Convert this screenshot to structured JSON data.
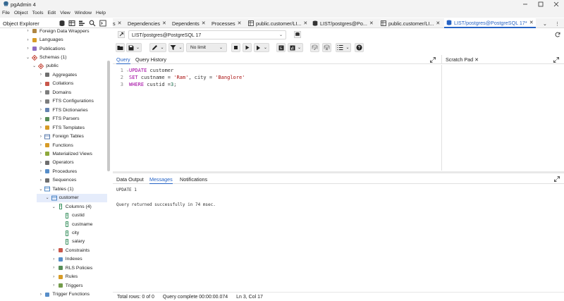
{
  "window": {
    "title": "pgAdmin 4",
    "controls": [
      "minimize",
      "maximize",
      "close"
    ]
  },
  "menu": [
    "File",
    "Object",
    "Tools",
    "Edit",
    "View",
    "Window",
    "Help"
  ],
  "object_explorer": {
    "title": "Object Explorer",
    "tree": [
      {
        "label": "Foreign Data Wrappers",
        "icon": "fdw-icon",
        "depth": 1,
        "state": "collapsed"
      },
      {
        "label": "Languages",
        "icon": "language-icon",
        "depth": 1,
        "state": "collapsed"
      },
      {
        "label": "Publications",
        "icon": "publication-icon",
        "depth": 1,
        "state": "collapsed"
      },
      {
        "label": "Schemas (1)",
        "icon": "schema-icon",
        "depth": 1,
        "state": "expanded"
      },
      {
        "label": "public",
        "icon": "public-schema-icon",
        "depth": 2,
        "state": "expanded"
      },
      {
        "label": "Aggregates",
        "icon": "aggregate-icon",
        "depth": 3,
        "state": "collapsed"
      },
      {
        "label": "Collations",
        "icon": "collation-icon",
        "depth": 3,
        "state": "collapsed"
      },
      {
        "label": "Domains",
        "icon": "domain-icon",
        "depth": 3,
        "state": "collapsed"
      },
      {
        "label": "FTS Configurations",
        "icon": "fts-config-icon",
        "depth": 3,
        "state": "collapsed"
      },
      {
        "label": "FTS Dictionaries",
        "icon": "fts-dictionary-icon",
        "depth": 3,
        "state": "collapsed"
      },
      {
        "label": "FTS Parsers",
        "icon": "fts-parser-icon",
        "depth": 3,
        "state": "collapsed"
      },
      {
        "label": "FTS Templates",
        "icon": "fts-template-icon",
        "depth": 3,
        "state": "collapsed"
      },
      {
        "label": "Foreign Tables",
        "icon": "foreign-table-icon",
        "depth": 3,
        "state": "collapsed"
      },
      {
        "label": "Functions",
        "icon": "function-icon",
        "depth": 3,
        "state": "collapsed"
      },
      {
        "label": "Materialized Views",
        "icon": "materialized-view-icon",
        "depth": 3,
        "state": "collapsed"
      },
      {
        "label": "Operators",
        "icon": "operator-icon",
        "depth": 3,
        "state": "collapsed"
      },
      {
        "label": "Procedures",
        "icon": "procedure-icon",
        "depth": 3,
        "state": "collapsed"
      },
      {
        "label": "Sequences",
        "icon": "sequence-icon",
        "depth": 3,
        "state": "collapsed"
      },
      {
        "label": "Tables (1)",
        "icon": "tables-icon",
        "depth": 3,
        "state": "expanded"
      },
      {
        "label": "customer",
        "icon": "table-icon",
        "depth": 4,
        "state": "expanded",
        "selected": true
      },
      {
        "label": "Columns (4)",
        "icon": "columns-icon",
        "depth": 5,
        "state": "expanded"
      },
      {
        "label": "custid",
        "icon": "column-icon",
        "depth": 6,
        "state": "leaf"
      },
      {
        "label": "custname",
        "icon": "column-icon",
        "depth": 6,
        "state": "leaf"
      },
      {
        "label": "city",
        "icon": "column-icon",
        "depth": 6,
        "state": "leaf"
      },
      {
        "label": "salary",
        "icon": "column-icon",
        "depth": 6,
        "state": "leaf"
      },
      {
        "label": "Constraints",
        "icon": "constraint-icon",
        "depth": 5,
        "state": "collapsed"
      },
      {
        "label": "Indexes",
        "icon": "index-icon",
        "depth": 5,
        "state": "collapsed"
      },
      {
        "label": "RLS Policies",
        "icon": "rls-policy-icon",
        "depth": 5,
        "state": "collapsed"
      },
      {
        "label": "Rules",
        "icon": "rule-icon",
        "depth": 5,
        "state": "collapsed"
      },
      {
        "label": "Triggers",
        "icon": "trigger-icon",
        "depth": 5,
        "state": "collapsed"
      },
      {
        "label": "Trigger Functions",
        "icon": "trigger-function-icon",
        "depth": 3,
        "state": "collapsed"
      }
    ]
  },
  "tabs": [
    {
      "label": "s",
      "icon": "",
      "active": false
    },
    {
      "label": "Dependencies",
      "icon": "",
      "active": false
    },
    {
      "label": "Dependents",
      "icon": "",
      "active": false
    },
    {
      "label": "Processes",
      "icon": "",
      "active": false
    },
    {
      "label": "public.customer/LI...",
      "icon": "grid-icon",
      "active": false
    },
    {
      "label": "LIST/postgres@Po...",
      "icon": "query-tool-icon",
      "active": false
    },
    {
      "label": "public.customer/LI...",
      "icon": "grid-icon",
      "active": false
    },
    {
      "label": "LIST/postgres@PostgreSQL 17*",
      "icon": "query-tool-icon",
      "active": true
    }
  ],
  "connection": {
    "value": "LIST/postgres@PostgreSQL 17"
  },
  "toolbar": {
    "limit_label": "No limit"
  },
  "editor": {
    "tabs": [
      "Query",
      "Query History"
    ],
    "active_tab": "Query",
    "line_numbers": [
      "1",
      "2",
      "3"
    ],
    "lines": [
      [
        {
          "t": "UPDATE",
          "c": "kw"
        },
        {
          "t": " customer",
          "c": "id"
        }
      ],
      [
        {
          "t": "SET",
          "c": "kw"
        },
        {
          "t": " custname = ",
          "c": "id"
        },
        {
          "t": "'Ram'",
          "c": "str"
        },
        {
          "t": ", city = ",
          "c": "id"
        },
        {
          "t": "'Banglore'",
          "c": "str"
        }
      ],
      [
        {
          "t": "WHERE",
          "c": "kw"
        },
        {
          "t": " custid =",
          "c": "id"
        },
        {
          "t": "3",
          "c": "num"
        },
        {
          "t": ";",
          "c": "id"
        }
      ]
    ]
  },
  "scratch_pad": {
    "title": "Scratch Pad"
  },
  "output": {
    "tabs": [
      "Data Output",
      "Messages",
      "Notifications"
    ],
    "active_tab": "Messages",
    "messages": [
      "UPDATE 1",
      "Query returned successfully in 74 msec."
    ]
  },
  "status": {
    "total_rows": "Total rows: 0 of 0",
    "query_complete": "Query complete 00:00:00.074",
    "cursor": "Ln 3, Col 17"
  },
  "colors": {
    "accent": "#2663c5",
    "keyword": "#a000a0",
    "string": "#aa1111"
  }
}
